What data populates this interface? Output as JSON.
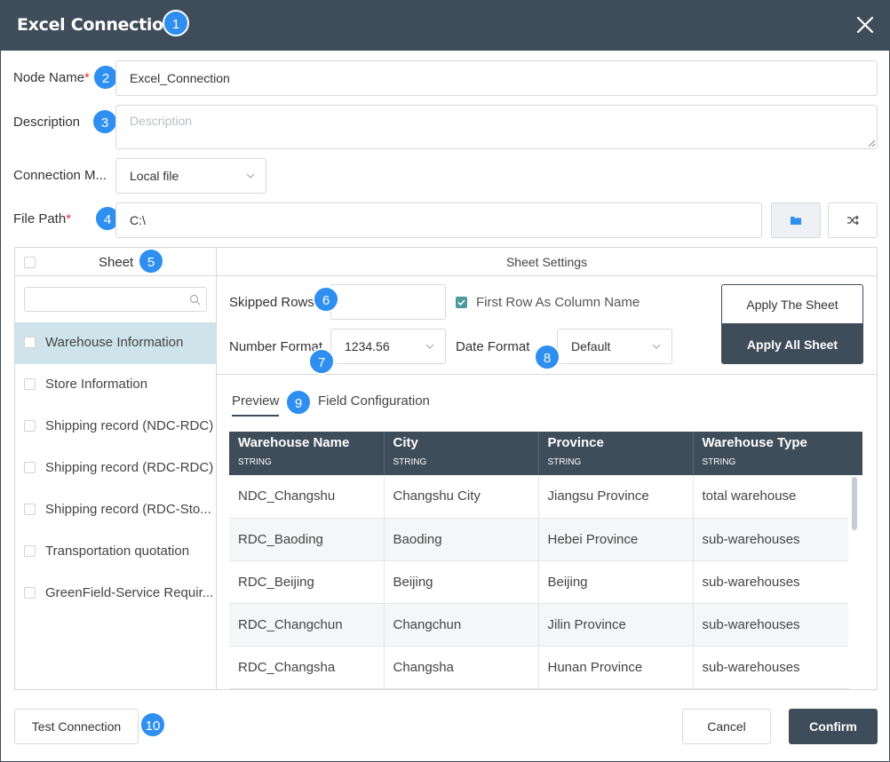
{
  "dialog": {
    "title": "Excel Connection",
    "badges": [
      "1",
      "2",
      "3",
      "4",
      "5",
      "6",
      "7",
      "8",
      "9",
      "10"
    ]
  },
  "form": {
    "node_name_label": "Node Name",
    "node_name_value": "Excel_Connection",
    "required_mark": "*",
    "description_label": "Description",
    "description_placeholder": "Description",
    "connection_label": "Connection M...",
    "connection_value": "Local file",
    "file_path_label": "File Path",
    "file_path_value": "C:\\"
  },
  "sheets": {
    "header": "Sheet",
    "search_placeholder": "",
    "items": [
      {
        "label": "Warehouse Information",
        "selected": true
      },
      {
        "label": "Store Information",
        "selected": false
      },
      {
        "label": "Shipping record (NDC-RDC)",
        "selected": false
      },
      {
        "label": "Shipping record (RDC-RDC)",
        "selected": false
      },
      {
        "label": "Shipping record (RDC-Sto...",
        "selected": false
      },
      {
        "label": "Transportation quotation",
        "selected": false
      },
      {
        "label": "GreenField-Service Requir...",
        "selected": false
      }
    ]
  },
  "settings": {
    "header": "Sheet Settings",
    "skipped_rows_label": "Skipped Rows",
    "skipped_rows_value": "",
    "first_row_label": "First Row As Column Name",
    "first_row_checked": true,
    "number_format_label": "Number Format",
    "number_format_value": "1234.56",
    "date_format_label": "Date Format",
    "date_format_value": "Default",
    "apply_sheet": "Apply The Sheet",
    "apply_all": "Apply All Sheet"
  },
  "tabs": {
    "preview": "Preview",
    "field_config": "Field Configuration"
  },
  "table": {
    "columns": [
      {
        "name": "Warehouse Name",
        "type": "STRING"
      },
      {
        "name": "City",
        "type": "STRING"
      },
      {
        "name": "Province",
        "type": "STRING"
      },
      {
        "name": "Warehouse Type",
        "type": "STRING"
      }
    ],
    "rows": [
      [
        "NDC_Changshu",
        "Changshu City",
        "Jiangsu Province",
        "total warehouse"
      ],
      [
        "RDC_Baoding",
        "Baoding",
        "Hebei Province",
        "sub-warehouses"
      ],
      [
        "RDC_Beijing",
        "Beijing",
        "Beijing",
        "sub-warehouses"
      ],
      [
        "RDC_Changchun",
        "Changchun",
        "Jilin Province",
        "sub-warehouses"
      ],
      [
        "RDC_Changsha",
        "Changsha",
        "Hunan Province",
        "sub-warehouses"
      ]
    ]
  },
  "footer": {
    "test_connection": "Test Connection",
    "cancel": "Cancel",
    "confirm": "Confirm"
  },
  "colors": {
    "header_bg": "#3f4c5a",
    "badge": "#2e8ff0",
    "selected_row": "#cfe3ea",
    "checkbox_on": "#4e9a9a"
  }
}
